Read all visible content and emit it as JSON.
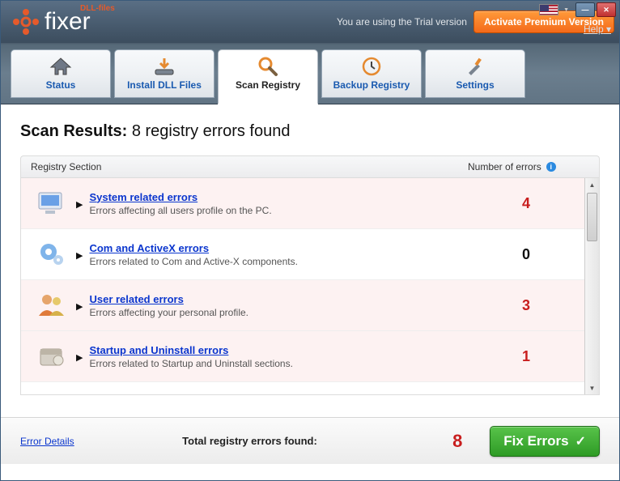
{
  "header": {
    "logo_sub": "DLL-files",
    "logo_text": "fixer",
    "trial_msg": "You are using the Trial version",
    "activate_label": "Activate Premium Version",
    "help_label": "Help"
  },
  "tabs": [
    {
      "label": "Status"
    },
    {
      "label": "Install DLL Files"
    },
    {
      "label": "Scan Registry"
    },
    {
      "label": "Backup Registry"
    },
    {
      "label": "Settings"
    }
  ],
  "results": {
    "title_bold": "Scan Results:",
    "title_rest": "8 registry errors found"
  },
  "columns": {
    "section": "Registry Section",
    "errors": "Number of errors"
  },
  "rows": [
    {
      "title": "System related errors",
      "desc": "Errors affecting all users profile on the PC.",
      "count": "4",
      "has_errors": true
    },
    {
      "title": "Com and ActiveX errors",
      "desc": "Errors related to Com and Active-X components.",
      "count": "0",
      "has_errors": false
    },
    {
      "title": "User related errors",
      "desc": "Errors affecting your personal profile.",
      "count": "3",
      "has_errors": true
    },
    {
      "title": "Startup and Uninstall errors",
      "desc": "Errors related to Startup and Uninstall sections.",
      "count": "1",
      "has_errors": true
    }
  ],
  "footer": {
    "details_link": "Error Details",
    "total_label": "Total registry errors found:",
    "total_value": "8",
    "fix_label": "Fix Errors"
  }
}
